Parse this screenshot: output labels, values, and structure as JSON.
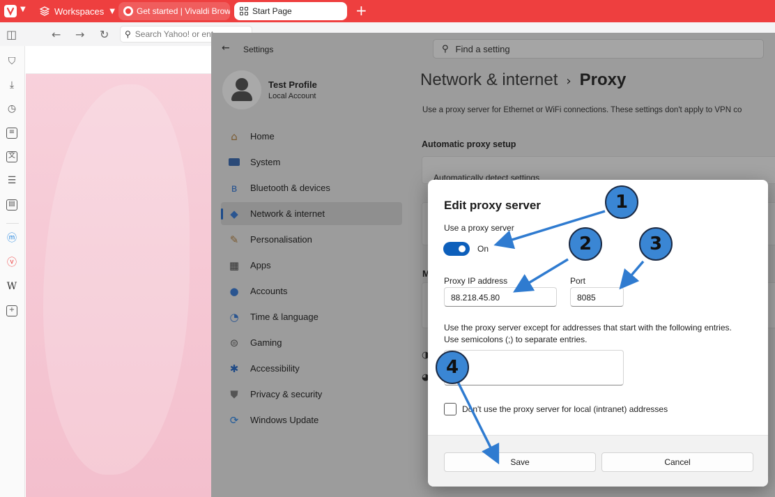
{
  "browser": {
    "workspaces_label": "Workspaces",
    "tabs": [
      {
        "label": "Get started | Vivaldi Browser"
      },
      {
        "label": "Start Page"
      }
    ],
    "new_tab": "+",
    "url_placeholder": "Search Yahoo! or ent"
  },
  "settings": {
    "window_title": "Settings",
    "search_placeholder": "Find a setting",
    "profile": {
      "name": "Test Profile",
      "type": "Local Account"
    },
    "nav": [
      {
        "label": "Home",
        "icon": "home-icon"
      },
      {
        "label": "System",
        "icon": "monitor-icon"
      },
      {
        "label": "Bluetooth & devices",
        "icon": "bluetooth-icon"
      },
      {
        "label": "Network & internet",
        "icon": "wifi-icon",
        "active": true
      },
      {
        "label": "Personalisation",
        "icon": "brush-icon"
      },
      {
        "label": "Apps",
        "icon": "apps-icon"
      },
      {
        "label": "Accounts",
        "icon": "person-icon"
      },
      {
        "label": "Time & language",
        "icon": "clock-globe-icon"
      },
      {
        "label": "Gaming",
        "icon": "gamepad-icon"
      },
      {
        "label": "Accessibility",
        "icon": "accessibility-icon"
      },
      {
        "label": "Privacy & security",
        "icon": "shield-icon"
      },
      {
        "label": "Windows Update",
        "icon": "update-icon"
      }
    ],
    "breadcrumb": {
      "parent": "Network & internet",
      "separator": "›",
      "current": "Proxy"
    },
    "description": "Use a proxy server for Ethernet or WiFi connections. These settings don't apply to VPN co",
    "auto_section": "Automatic proxy setup",
    "auto_detect": "Automatically detect settings",
    "manual_letter": "M"
  },
  "dialog": {
    "title": "Edit proxy server",
    "use_proxy_label": "Use a proxy server",
    "toggle_state": "On",
    "ip_label": "Proxy IP address",
    "ip_value": "88.218.45.80",
    "port_label": "Port",
    "port_value": "8085",
    "exceptions_text_1": "Use the proxy server except for addresses that start with the following entries.",
    "exceptions_text_2": "Use semicolons (;) to separate entries.",
    "exceptions_value": "",
    "local_checkbox_label": "Don't use the proxy server for local (intranet) addresses",
    "save_label": "Save",
    "cancel_label": "Cancel"
  },
  "annotations": [
    "1",
    "2",
    "3",
    "4"
  ],
  "colors": {
    "vivaldi_red": "#ee3f3f",
    "toggle_blue": "#0d5fbb",
    "badge_blue": "#3a86d4"
  }
}
